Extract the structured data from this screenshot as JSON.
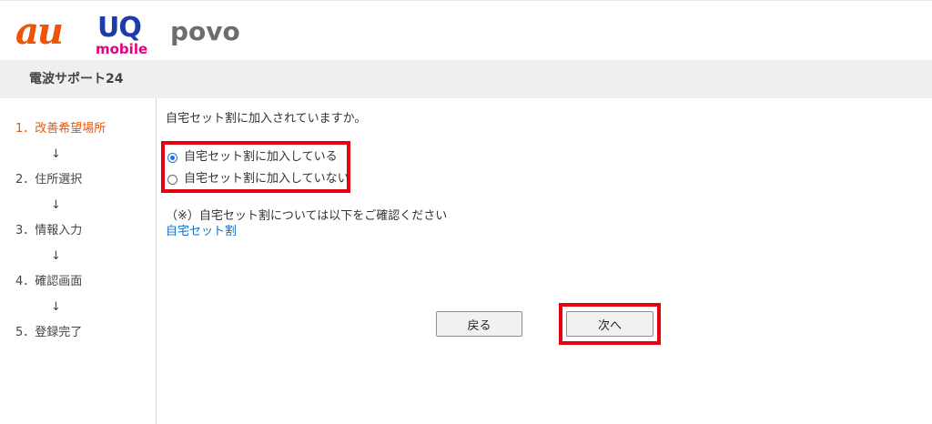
{
  "header": {
    "logo_au": "au",
    "logo_uq_top": "UQ",
    "logo_uq_bottom": "mobile",
    "logo_povo": "povo",
    "service_title": "電波サポート24"
  },
  "sidebar": {
    "steps": [
      {
        "label": "1．改善希望場所",
        "active": true
      },
      {
        "label": "2．住所選択",
        "active": false
      },
      {
        "label": "3．情報入力",
        "active": false
      },
      {
        "label": "4．確認画面",
        "active": false
      },
      {
        "label": "5．登録完了",
        "active": false
      }
    ],
    "arrow": "↓"
  },
  "main": {
    "question": "自宅セット割に加入されていますか。",
    "options": [
      {
        "label": "自宅セット割に加入している",
        "checked": true
      },
      {
        "label": "自宅セット割に加入していない",
        "checked": false
      }
    ],
    "note": "（※）自宅セット割については以下をご確認ください",
    "link_label": "自宅セット割",
    "back_label": "戻る",
    "next_label": "次へ"
  },
  "colors": {
    "au_orange": "#eb5505",
    "uq_blue": "#1e3ca8",
    "uq_pink": "#e6007e",
    "povo_gray": "#6d6d6d",
    "highlight_red": "#e60012",
    "active_step": "#eb5505",
    "link_blue": "#1a6fc9",
    "radio_blue": "#1a73e8"
  }
}
